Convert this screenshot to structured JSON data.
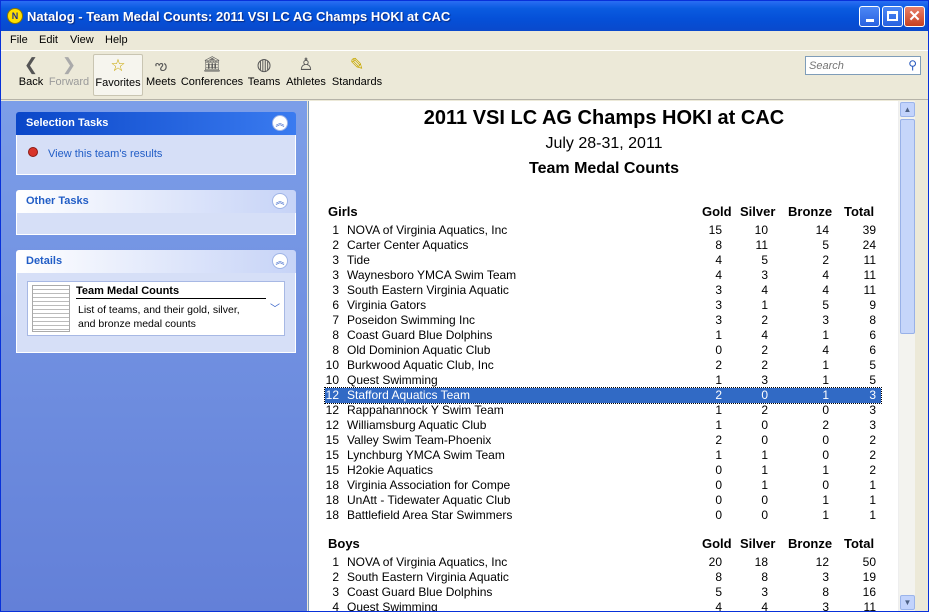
{
  "window": {
    "app_icon": "N",
    "title": "Natalog - Team Medal Counts: 2011 VSI LC AG Champs HOKI at CAC",
    "buttons": {
      "min": "minimize-icon",
      "max": "maximize-icon",
      "close": "close-icon"
    }
  },
  "menu": [
    "File",
    "Edit",
    "View",
    "Help"
  ],
  "toolbar": [
    {
      "name": "back",
      "label": "Back",
      "icon": "back-arrow-icon",
      "glyph": "❮",
      "enabled": true
    },
    {
      "name": "forward",
      "label": "Forward",
      "icon": "forward-arrow-icon",
      "glyph": "❯",
      "enabled": false
    },
    {
      "name": "favorites",
      "label": "Favorites",
      "icon": "star-icon",
      "glyph": "☆",
      "enabled": true,
      "selected": true
    },
    {
      "name": "meets",
      "label": "Meets",
      "icon": "swimmer-icon",
      "glyph": "ఌ",
      "enabled": true
    },
    {
      "name": "conferences",
      "label": "Conferences",
      "icon": "building-icon",
      "glyph": "🏛",
      "enabled": true
    },
    {
      "name": "teams",
      "label": "Teams",
      "icon": "cap-icon",
      "glyph": "◍",
      "enabled": true
    },
    {
      "name": "athletes",
      "label": "Athletes",
      "icon": "person-icon",
      "glyph": "♙",
      "enabled": true
    },
    {
      "name": "standards",
      "label": "Standards",
      "icon": "pencil-icon",
      "glyph": "✎",
      "enabled": true
    }
  ],
  "search": {
    "placeholder": "Search",
    "icon": "search-icon"
  },
  "sidebar": {
    "selection_tasks": {
      "title": "Selection Tasks",
      "link": "View this team's results",
      "link_icon": "ribbon-icon"
    },
    "other_tasks": {
      "title": "Other Tasks"
    },
    "details": {
      "title": "Details",
      "heading": "Team Medal Counts",
      "description": "List of teams, and their gold, silver, and bronze medal counts",
      "thumb_icon": "document-thumbnail-icon"
    }
  },
  "report": {
    "title": "2011 VSI LC AG Champs HOKI at CAC",
    "date": "July 28-31, 2011",
    "subtitle": "Team Medal Counts",
    "columns": [
      "Gold",
      "Silver",
      "Bronze",
      "Total"
    ],
    "girls": {
      "label": "Girls",
      "rows": [
        {
          "rank": "1",
          "team": "NOVA of Virginia Aquatics, Inc",
          "gold": "15",
          "silver": "10",
          "bronze": "14",
          "total": "39"
        },
        {
          "rank": "2",
          "team": "Carter Center Aquatics",
          "gold": "8",
          "silver": "11",
          "bronze": "5",
          "total": "24"
        },
        {
          "rank": "3",
          "team": "Tide",
          "gold": "4",
          "silver": "5",
          "bronze": "2",
          "total": "11"
        },
        {
          "rank": "3",
          "team": "Waynesboro YMCA Swim Team",
          "gold": "4",
          "silver": "3",
          "bronze": "4",
          "total": "11"
        },
        {
          "rank": "3",
          "team": "South Eastern Virginia Aquatic",
          "gold": "3",
          "silver": "4",
          "bronze": "4",
          "total": "11"
        },
        {
          "rank": "6",
          "team": "Virginia Gators",
          "gold": "3",
          "silver": "1",
          "bronze": "5",
          "total": "9"
        },
        {
          "rank": "7",
          "team": "Poseidon Swimming Inc",
          "gold": "3",
          "silver": "2",
          "bronze": "3",
          "total": "8"
        },
        {
          "rank": "8",
          "team": "Coast Guard Blue Dolphins",
          "gold": "1",
          "silver": "4",
          "bronze": "1",
          "total": "6"
        },
        {
          "rank": "8",
          "team": "Old Dominion Aquatic Club",
          "gold": "0",
          "silver": "2",
          "bronze": "4",
          "total": "6"
        },
        {
          "rank": "10",
          "team": "Burkwood Aquatic Club, Inc",
          "gold": "2",
          "silver": "2",
          "bronze": "1",
          "total": "5"
        },
        {
          "rank": "10",
          "team": "Quest Swimming",
          "gold": "1",
          "silver": "3",
          "bronze": "1",
          "total": "5"
        },
        {
          "rank": "12",
          "team": "Stafford Aquatics Team",
          "gold": "2",
          "silver": "0",
          "bronze": "1",
          "total": "3",
          "selected": true
        },
        {
          "rank": "12",
          "team": "Rappahannock Y Swim Team",
          "gold": "1",
          "silver": "2",
          "bronze": "0",
          "total": "3"
        },
        {
          "rank": "12",
          "team": "Williamsburg Aquatic Club",
          "gold": "1",
          "silver": "0",
          "bronze": "2",
          "total": "3"
        },
        {
          "rank": "15",
          "team": "Valley Swim Team-Phoenix",
          "gold": "2",
          "silver": "0",
          "bronze": "0",
          "total": "2"
        },
        {
          "rank": "15",
          "team": "Lynchburg YMCA Swim Team",
          "gold": "1",
          "silver": "1",
          "bronze": "0",
          "total": "2"
        },
        {
          "rank": "15",
          "team": "H2okie Aquatics",
          "gold": "0",
          "silver": "1",
          "bronze": "1",
          "total": "2"
        },
        {
          "rank": "18",
          "team": "Virginia Association for Compe",
          "gold": "0",
          "silver": "1",
          "bronze": "0",
          "total": "1"
        },
        {
          "rank": "18",
          "team": "UnAtt - Tidewater Aquatic Club",
          "gold": "0",
          "silver": "0",
          "bronze": "1",
          "total": "1"
        },
        {
          "rank": "18",
          "team": "Battlefield Area Star Swimmers",
          "gold": "0",
          "silver": "0",
          "bronze": "1",
          "total": "1"
        }
      ]
    },
    "boys": {
      "label": "Boys",
      "rows": [
        {
          "rank": "1",
          "team": "NOVA of Virginia Aquatics, Inc",
          "gold": "20",
          "silver": "18",
          "bronze": "12",
          "total": "50"
        },
        {
          "rank": "2",
          "team": "South Eastern Virginia Aquatic",
          "gold": "8",
          "silver": "8",
          "bronze": "3",
          "total": "19"
        },
        {
          "rank": "3",
          "team": "Coast Guard Blue Dolphins",
          "gold": "5",
          "silver": "3",
          "bronze": "8",
          "total": "16"
        },
        {
          "rank": "4",
          "team": "Quest Swimming",
          "gold": "4",
          "silver": "4",
          "bronze": "3",
          "total": "11"
        }
      ]
    }
  },
  "colors": {
    "selection": "#316ac5",
    "title_bar": "#0a5be0",
    "task_pane": "#6f8fe0",
    "link": "#215dc6"
  }
}
